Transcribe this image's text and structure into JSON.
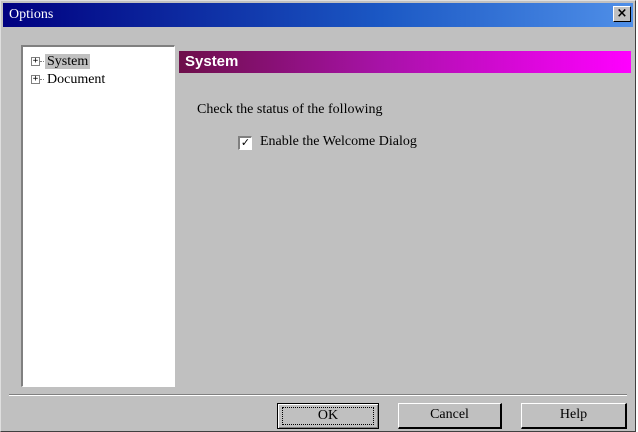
{
  "window": {
    "title": "Options",
    "close_glyph": "×"
  },
  "tree": {
    "items": [
      {
        "label": "System",
        "expander": "+",
        "selected": true
      },
      {
        "label": "Document",
        "expander": "+",
        "selected": false
      }
    ]
  },
  "panel": {
    "header": "System",
    "group_text": "Check the status of the following",
    "checkbox": {
      "label": "Enable the Welcome Dialog",
      "checked": true,
      "mark": "✓"
    }
  },
  "buttons": {
    "ok": "OK",
    "cancel": "Cancel",
    "help": "Help"
  },
  "colors": {
    "titlebar_start": "#000080",
    "titlebar_end": "#4f8fe8",
    "header_start": "#6d0f4a",
    "header_end": "#ff00ff",
    "face": "#c0c0c0"
  },
  "icons": [
    "close-icon",
    "tree-expand-icon",
    "checkmark-icon"
  ]
}
